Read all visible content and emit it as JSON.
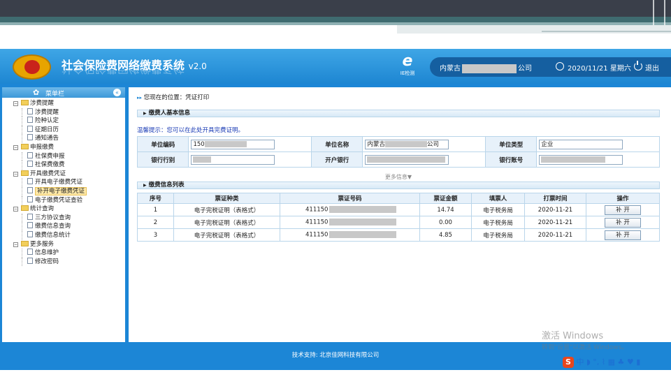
{
  "header": {
    "title": "社会保险费网络缴费系统",
    "version": "v2.0",
    "ie_label": "IE检测",
    "company_prefix": "内蒙古",
    "company_suffix": "公司",
    "datetime": "2020/11/21 星期六",
    "logout": "退出",
    "colors": {
      "header_bg": "#1d86d2",
      "pill_bg": "#155fa0"
    }
  },
  "sidebar": {
    "title": "菜单栏",
    "groups": [
      {
        "label": "涉费提醒",
        "items": [
          "涉费提醒",
          "险种认定",
          "征期日历",
          "通知通告"
        ]
      },
      {
        "label": "申报缴费",
        "items": [
          "社保费申报",
          "社保费缴费"
        ]
      },
      {
        "label": "开具缴费凭证",
        "items": [
          "开具电子缴费凭证",
          "补开电子缴费凭证",
          "电子缴费凭证查验"
        ]
      },
      {
        "label": "统计查询",
        "items": [
          "三方协议查询",
          "缴费信息查询",
          "缴费信息统计"
        ]
      },
      {
        "label": "更多服务",
        "items": [
          "信息维护",
          "修改密码"
        ]
      }
    ],
    "selected": "补开电子缴费凭证"
  },
  "main": {
    "location": "您现在的位置：凭证打印",
    "section_basic": "缴费人基本信息",
    "hint": "温馨提示：您可以在此处开具完费证明。",
    "fields": {
      "unit_code_label": "单位编码",
      "unit_code_value": "150",
      "unit_name_label": "单位名称",
      "unit_name_prefix": "内蒙古",
      "unit_name_suffix": "公司",
      "unit_type_label": "单位类型",
      "unit_type_value": "企业",
      "bank_branch_label": "银行行别",
      "open_bank_label": "开户银行",
      "bank_account_label": "银行账号"
    },
    "more": "更多信息▼",
    "section_list": "缴费信息列表",
    "columns": [
      "序号",
      "票证种类",
      "票证号码",
      "票证金额",
      "填票人",
      "打票时间",
      "操作"
    ],
    "rows": [
      {
        "seq": "1",
        "type": "电子完税证明（表格式）",
        "number_prefix": "411150",
        "amount": "14.74",
        "issuer": "电子税务局",
        "time": "2020-11-21",
        "action": "补 开"
      },
      {
        "seq": "2",
        "type": "电子完税证明（表格式）",
        "number_prefix": "411150",
        "amount": "0.00",
        "issuer": "电子税务局",
        "time": "2020-11-21",
        "action": "补 开"
      },
      {
        "seq": "3",
        "type": "电子完税证明（表格式）",
        "number_prefix": "411150",
        "amount": "4.85",
        "issuer": "电子税务局",
        "time": "2020-11-21",
        "action": "补 开"
      }
    ]
  },
  "footer": {
    "text": "技术支持: 北京佳网科技有限公司"
  },
  "overlay": {
    "watermark_line1": "激活 Windows",
    "watermark_line2": "转到\"设置\"以激活 Windows。",
    "tray_text": "中 ◗ °, ⌇ ▦ ♣ ♥ ▮"
  }
}
